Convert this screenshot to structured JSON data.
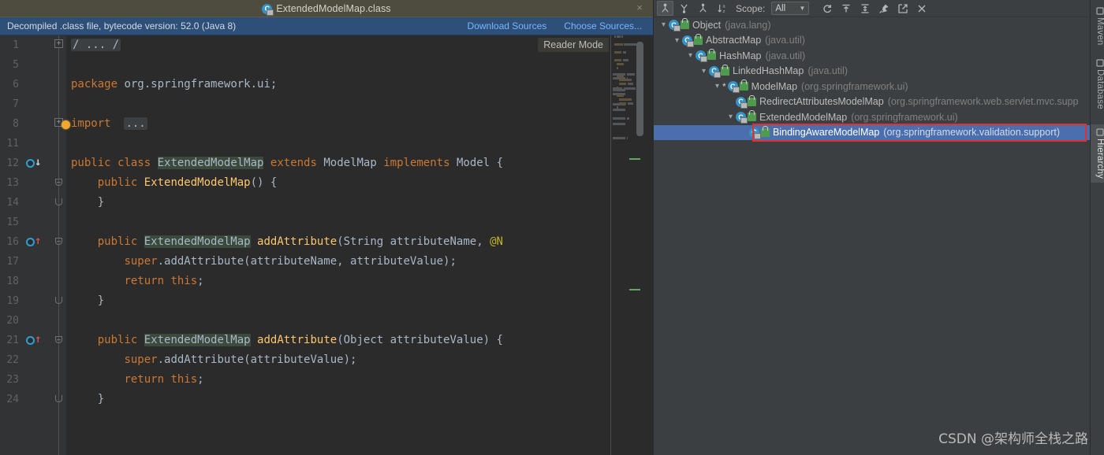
{
  "editor": {
    "tab": {
      "title": "ExtendedModelMap.class",
      "icon": "java-class-icon",
      "close_label": "×"
    },
    "notification": {
      "text": "Decompiled .class file, bytecode version: 52.0 (Java 8)",
      "links": [
        "Download Sources",
        "Choose Sources..."
      ]
    },
    "reader_mode_label": "Reader Mode",
    "lines": [
      {
        "num": "1",
        "fold": "plus",
        "marker": "",
        "html": "<span class=\"cm fold-ph\">/ ... /</span>"
      },
      {
        "num": "5",
        "fold": "",
        "marker": "",
        "html": ""
      },
      {
        "num": "6",
        "fold": "",
        "marker": "",
        "html": "<span class=\"kw\">package</span> <span class=\"pl\">org.springframework.ui;</span>"
      },
      {
        "num": "7",
        "fold": "",
        "marker": "",
        "html": ""
      },
      {
        "num": "8",
        "fold": "plus",
        "marker": "bulb",
        "html": "<span class=\"kw\">import</span>  <span class=\"fold-ph\">...</span>"
      },
      {
        "num": "11",
        "fold": "",
        "marker": "",
        "html": ""
      },
      {
        "num": "12",
        "fold": "",
        "marker": "impl",
        "html": "<span class=\"kw\">public</span> <span class=\"kw\">class</span> <span class=\"hl pl\">ExtendedModelMap</span> <span class=\"kw\">extends</span> <span class=\"pl\">ModelMap</span> <span class=\"kw\">implements</span> <span class=\"pl\">Model</span> <span class=\"pl\">{</span>"
      },
      {
        "num": "13",
        "fold": "btop",
        "marker": "",
        "html": "    <span class=\"kw\">public</span> <span class=\"fn\">ExtendedModelMap</span><span class=\"pl\">() {</span>"
      },
      {
        "num": "14",
        "fold": "bbot",
        "marker": "",
        "html": "    <span class=\"pl\">}</span>"
      },
      {
        "num": "15",
        "fold": "",
        "marker": "",
        "html": ""
      },
      {
        "num": "16",
        "fold": "btop",
        "marker": "ovr",
        "html": "    <span class=\"kw\">public</span> <span class=\"hl pl\">ExtendedModelMap</span> <span class=\"fn\">addAttribute</span><span class=\"pl\">(String attributeName, </span><span class=\"ann\">@N</span>"
      },
      {
        "num": "17",
        "fold": "",
        "marker": "",
        "html": "        <span class=\"kw\">super</span><span class=\"pl\">.addAttribute(attributeName, attributeValue);</span>"
      },
      {
        "num": "18",
        "fold": "",
        "marker": "",
        "html": "        <span class=\"kw\">return</span> <span class=\"kw\">this</span><span class=\"pl\">;</span>"
      },
      {
        "num": "19",
        "fold": "bbot",
        "marker": "",
        "html": "    <span class=\"pl\">}</span>"
      },
      {
        "num": "20",
        "fold": "",
        "marker": "",
        "html": ""
      },
      {
        "num": "21",
        "fold": "btop",
        "marker": "ovr",
        "html": "    <span class=\"kw\">public</span> <span class=\"hl pl\">ExtendedModelMap</span> <span class=\"fn\">addAttribute</span><span class=\"pl\">(Object attributeValue) {</span>"
      },
      {
        "num": "22",
        "fold": "",
        "marker": "",
        "html": "        <span class=\"kw\">super</span><span class=\"pl\">.addAttribute(attributeValue);</span>"
      },
      {
        "num": "23",
        "fold": "",
        "marker": "",
        "html": "        <span class=\"kw\">return</span> <span class=\"kw\">this</span><span class=\"pl\">;</span>"
      },
      {
        "num": "24",
        "fold": "bbot",
        "marker": "",
        "html": "    <span class=\"pl\">}</span>"
      }
    ]
  },
  "hierarchy": {
    "toolbar": {
      "buttons": [
        {
          "name": "type-hierarchy-icon",
          "glyph": "⑂",
          "active": true
        },
        {
          "name": "supertypes-hierarchy-icon",
          "glyph": "⑂",
          "active": false
        },
        {
          "name": "subtypes-hierarchy-icon",
          "glyph": "⑂",
          "active": false
        },
        {
          "name": "sort-alphabetically-icon",
          "glyph": "↓",
          "active": false
        }
      ],
      "scope_label": "Scope:",
      "scope_value": "All",
      "right_buttons": [
        {
          "name": "refresh-icon",
          "glyph": "↻"
        },
        {
          "name": "expand-all-icon",
          "glyph": "⊤"
        },
        {
          "name": "collapse-all-icon",
          "glyph": "≡"
        },
        {
          "name": "pin-tab-icon",
          "glyph": "✒"
        },
        {
          "name": "open-in-editor-icon",
          "glyph": "↗"
        },
        {
          "name": "close-panel-icon",
          "glyph": "✕"
        }
      ]
    },
    "nodes": [
      {
        "indent": 0,
        "twisty": true,
        "star": false,
        "name": "Object",
        "pkg": "(java.lang)",
        "selected": false
      },
      {
        "indent": 1,
        "twisty": true,
        "star": false,
        "name": "AbstractMap",
        "pkg": "(java.util)",
        "selected": false
      },
      {
        "indent": 2,
        "twisty": true,
        "star": false,
        "name": "HashMap",
        "pkg": "(java.util)",
        "selected": false
      },
      {
        "indent": 3,
        "twisty": true,
        "star": false,
        "name": "LinkedHashMap",
        "pkg": "(java.util)",
        "selected": false
      },
      {
        "indent": 4,
        "twisty": true,
        "star": true,
        "name": "ModelMap",
        "pkg": "(org.springframework.ui)",
        "selected": false
      },
      {
        "indent": 5,
        "twisty": false,
        "star": false,
        "name": "RedirectAttributesModelMap",
        "pkg": "(org.springframework.web.servlet.mvc.supp",
        "selected": false
      },
      {
        "indent": 5,
        "twisty": true,
        "star": false,
        "name": "ExtendedModelMap",
        "pkg": "(org.springframework.ui)",
        "selected": false
      },
      {
        "indent": 6,
        "twisty": false,
        "star": false,
        "name": "BindingAwareModelMap",
        "pkg": "(org.springframework.validation.support)",
        "selected": true
      }
    ]
  },
  "tool_strip": {
    "tabs": [
      {
        "label": "Maven",
        "active": false
      },
      {
        "label": "Database",
        "active": false
      },
      {
        "label": "Hierarchy",
        "active": true
      }
    ]
  },
  "watermark": "CSDN @架构师全栈之路",
  "colors": {
    "editor_bg": "#2b2b2b",
    "gutter_bg": "#313335",
    "panel_bg": "#3c3f41",
    "tab_bg": "#4e4b3f",
    "notification_bg": "#2d4f78",
    "link": "#77b6ff",
    "selection": "#4b6eaf",
    "highlight_box": "#e03131",
    "keyword": "#cc7832",
    "method": "#ffc66d",
    "plain": "#a9b7c6",
    "annotation": "#bbb529",
    "class_icon": "#3592c4"
  }
}
